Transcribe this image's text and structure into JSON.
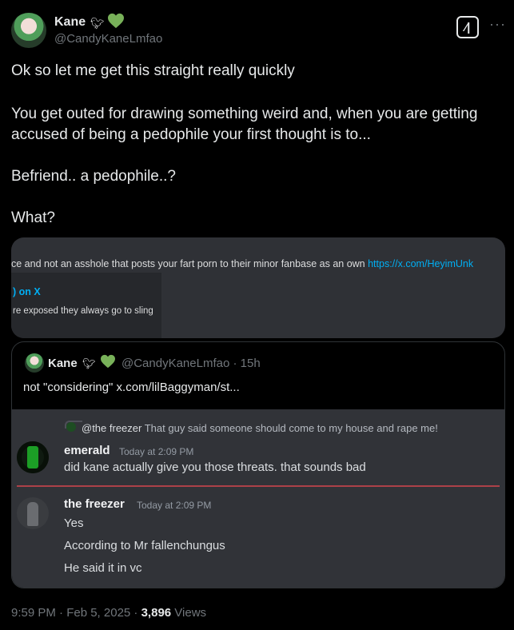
{
  "author": {
    "name": "Kane",
    "handle": "@CandyKaneLmfao",
    "badge_icon": "bird-icon",
    "emoji": "green-heart-icon",
    "accent": "#78b159"
  },
  "post": {
    "lines": [
      "Ok so let me get this straight really quickly",
      "You get outed for drawing something weird and, when you are getting",
      "accused of being a pedophile your first thought is to...",
      "Befriend.. a pedophile..?",
      "What?"
    ]
  },
  "image_card": {
    "message_text": "ce and not an asshole that posts your fart porn to their minor fanbase as an own ",
    "message_link": "https://x.com/HeyimUnk",
    "embed_title": ") on X",
    "embed_desc": "re exposed they always go to sling"
  },
  "quote": {
    "name": "Kane",
    "handle_time": "@CandyKaneLmfao · 15h",
    "text": "not \"considering\"  x.com/lilBaggyman/st...",
    "discord": {
      "reply_user": "@the freezer",
      "reply_text": "That guy said someone should come to my house and rape me!",
      "messages": [
        {
          "user": "emerald",
          "time": "Today at 2:09 PM",
          "lines": [
            "did kane actually give you those threats. that sounds bad"
          ]
        },
        {
          "user": "the freezer",
          "time": "Today at 2:09 PM",
          "lines": [
            "Yes",
            "According to Mr fallenchungus",
            "He said it in vc"
          ]
        }
      ]
    }
  },
  "footer": {
    "time_date": "9:59 PM · Feb 5, 2025 · ",
    "views_count": "3,896",
    "views_label": " Views"
  },
  "colors": {
    "link": "#00aff4",
    "separator": "#c2444b",
    "muted": "#71767b"
  }
}
